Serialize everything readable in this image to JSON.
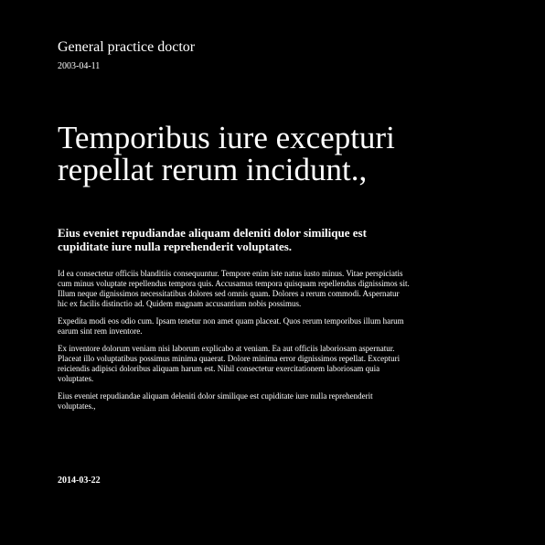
{
  "header": {
    "role": "General practice doctor",
    "date": "2003-04-11"
  },
  "headline": "Temporibus iure excepturi repellat rerum incidunt.,",
  "subheadline": "Eius eveniet repudiandae aliquam deleniti dolor similique est cupiditate iure nulla reprehenderit voluptates.",
  "body": {
    "paragraphs": [
      "Id ea consectetur officiis blanditiis consequuntur. Tempore enim iste natus iusto minus. Vitae perspiciatis cum minus voluptate repellendus tempora quis. Accusamus tempora quisquam repellendus dignissimos sit. Illum neque dignissimos necessitatibus dolores sed omnis quam. Dolores a rerum commodi. Aspernatur hic ex facilis distinctio ad. Quidem magnam accusantium nobis possimus.",
      "Expedita modi eos odio cum. Ipsam tenetur non amet quam placeat. Quos rerum temporibus illum harum earum sint rem inventore.",
      "Ex inventore dolorum veniam nisi laborum explicabo at veniam. Ea aut officiis laboriosam aspernatur. Placeat illo voluptatibus possimus minima quaerat. Dolore minima error dignissimos repellat. Excepturi reiciendis adipisci doloribus aliquam harum est. Nihil consectetur exercitationem laboriosam quia voluptates.",
      "Eius eveniet repudiandae aliquam deleniti dolor similique est cupiditate iure nulla reprehenderit voluptates.,"
    ]
  },
  "footer": {
    "date": "2014-03-22"
  },
  "colors": {
    "background": "#000000",
    "text": "#ffffff"
  }
}
